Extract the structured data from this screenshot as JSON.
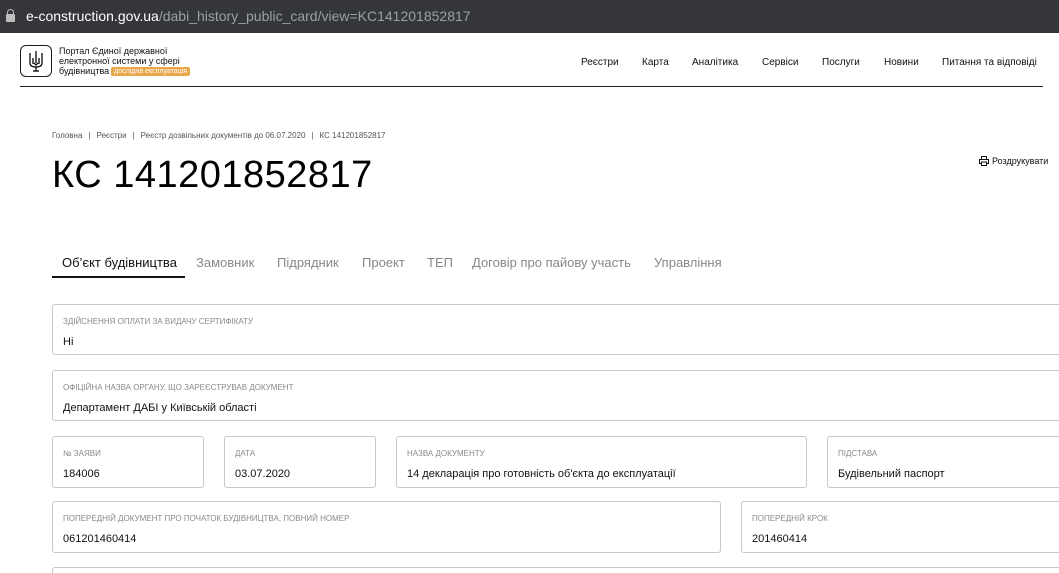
{
  "browser": {
    "url_host": "e-construction.gov.ua",
    "url_path": "/dabi_history_public_card/view=KC141201852817"
  },
  "header": {
    "portal_line1": "Портал Єдиної державної",
    "portal_line2": "електронної системи у сфері",
    "portal_line3": "будівництва",
    "badge": "дослідна експлуатація",
    "nav": [
      "Реєстри",
      "Карта",
      "Аналітика",
      "Сервіси",
      "Послуги",
      "Новини",
      "Питання та відповіді"
    ]
  },
  "breadcrumb": [
    "Головна",
    "Реєстри",
    "Реєстр дозвільних документів до 06.07.2020",
    "КС 141201852817"
  ],
  "title": "КС 141201852817",
  "print_label": "Роздрукувати",
  "tabs": [
    "Об’єкт будівництва",
    "Замовник",
    "Підрядник",
    "Проект",
    "ТЕП",
    "Договір про пайову участь",
    "Управління"
  ],
  "fields": {
    "payment": {
      "label": "Здійснення оплати за видачу сертифікату",
      "value": "Ні"
    },
    "authority": {
      "label": "Офіційна назва органу, що зареєстрував документ",
      "value": "Департамент ДАБІ у Київській області"
    },
    "app_no": {
      "label": "№ заяви",
      "value": "184006"
    },
    "date": {
      "label": "Дата",
      "value": "03.07.2020"
    },
    "doc_name": {
      "label": "Назва документу",
      "value": "14 декларація про готовність об'єкта до експлуатації"
    },
    "basis": {
      "label": "Підстава",
      "value": "Будівельний паспорт"
    },
    "prev_doc": {
      "label": "Попередній документ про початок будівництва, повний номер",
      "value": "061201460414"
    },
    "prev_step": {
      "label": "Попередній крок",
      "value": "201460414"
    }
  },
  "colors": {
    "badge": "#e9a74a",
    "address_bar": "#35363a"
  }
}
